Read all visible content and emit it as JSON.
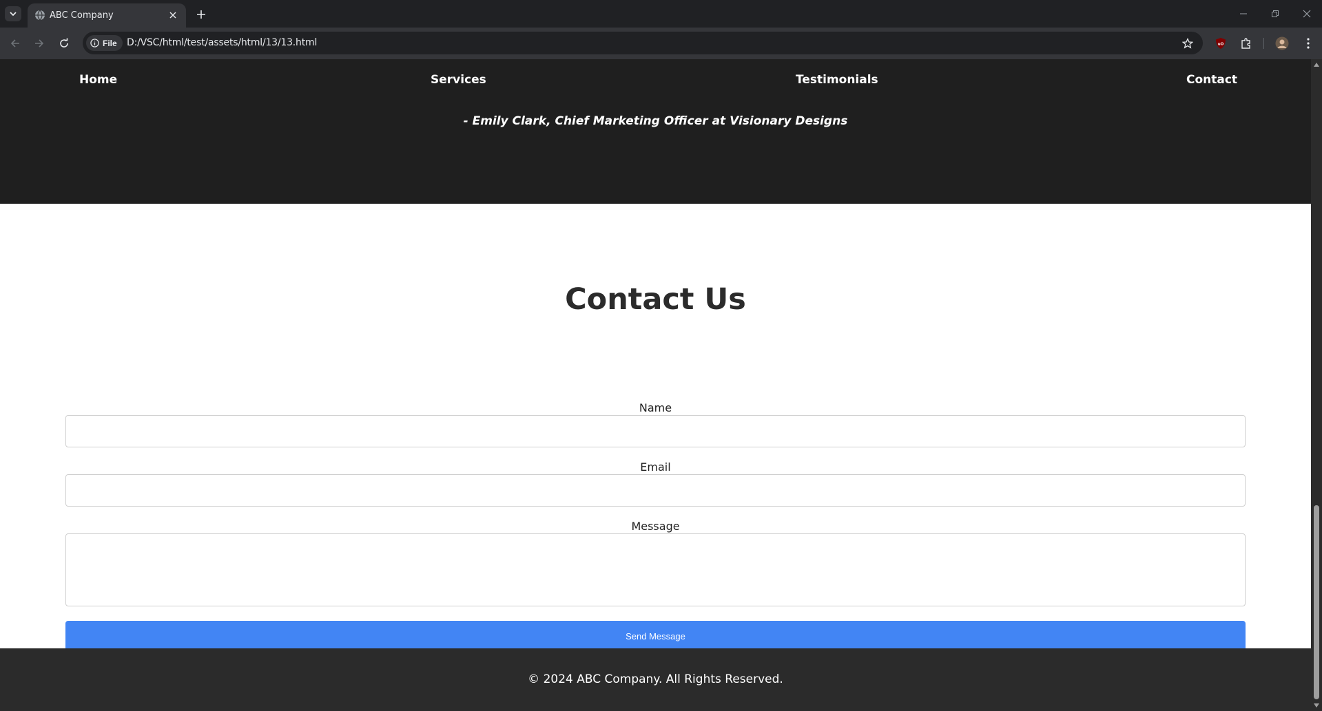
{
  "browser": {
    "tab_title": "ABC Company",
    "chip_label": "File",
    "url": "D:/VSC/html/test/assets/html/13/13.html"
  },
  "site": {
    "nav": [
      "Home",
      "Services",
      "Testimonials",
      "Contact"
    ],
    "quote_author": "- Emily Clark, Chief Marketing Officer at Visionary Designs",
    "contact": {
      "title": "Contact Us",
      "name_label": "Name",
      "email_label": "Email",
      "message_label": "Message",
      "name_value": "",
      "email_value": "",
      "message_value": "",
      "send_label": "Send Message"
    },
    "footer": "© 2024 ABC Company. All Rights Reserved."
  },
  "colors": {
    "hero_bg": "#1f1f1f",
    "button": "#4285f4",
    "footer_bg": "#2b2b2b"
  }
}
